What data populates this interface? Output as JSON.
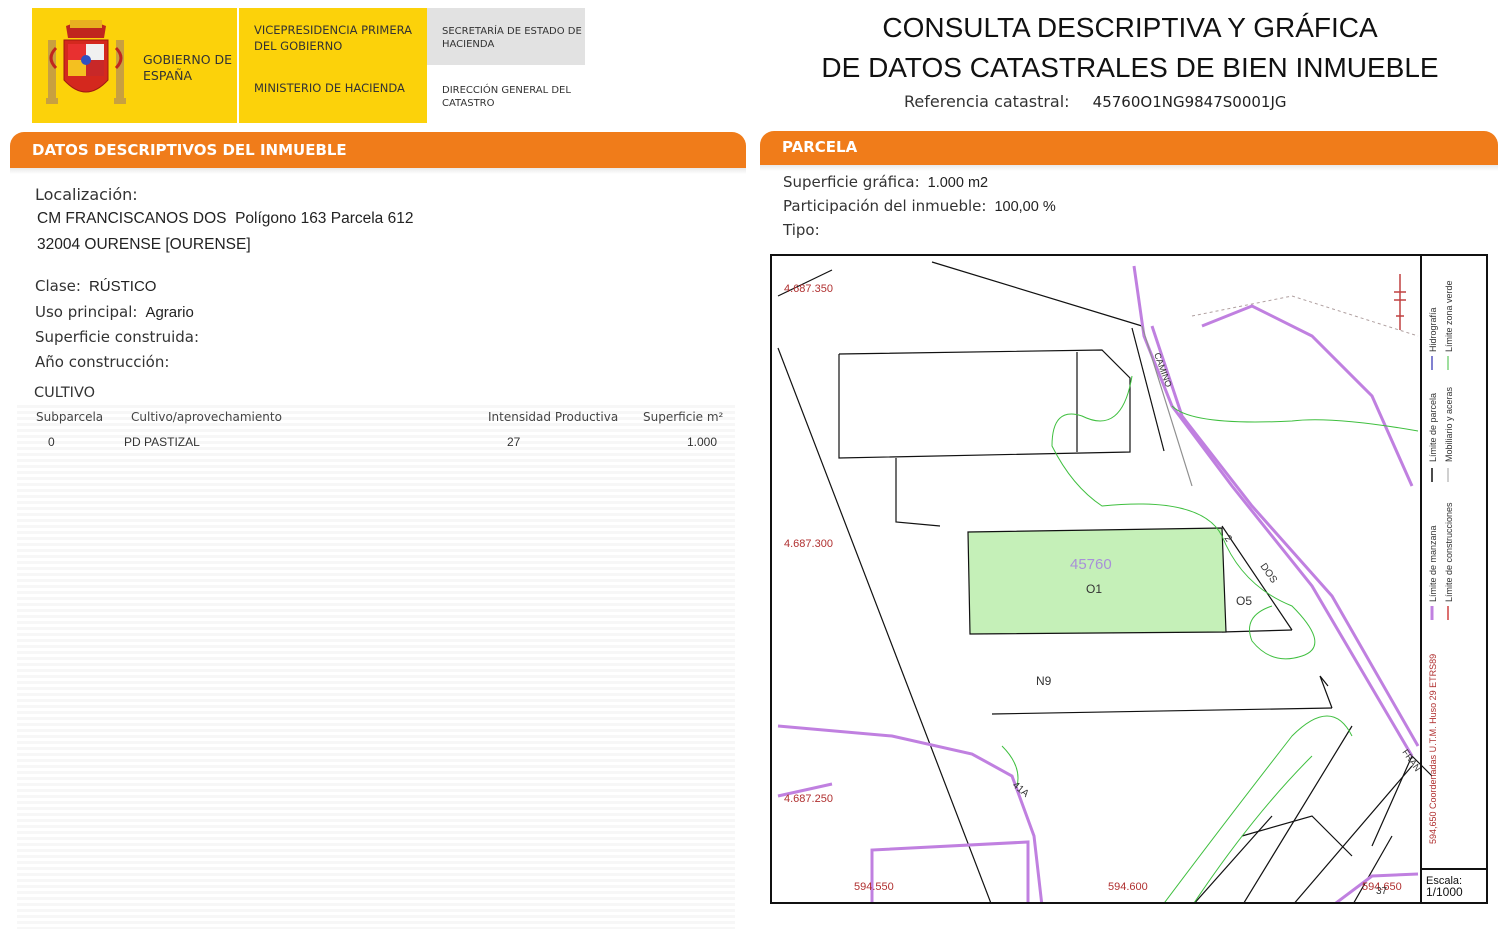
{
  "header": {
    "gobierno": "GOBIERNO DE ESPAÑA",
    "vicepresidencia": "VICEPRESIDENCIA PRIMERA DEL GOBIERNO",
    "ministerio": "MINISTERIO DE HACIENDA",
    "secretaria": "SECRETARÍA DE ESTADO DE HACIENDA",
    "direccion": "DIRECCIÓN GENERAL DEL CATASTRO",
    "title_line1": "CONSULTA DESCRIPTIVA Y GRÁFICA",
    "title_line2": "DE DATOS CATASTRALES DE BIEN INMUEBLE",
    "ref_label": "Referencia catastral:",
    "ref_value": "45760O1NG9847S0001JG",
    "colors": {
      "yellow": "#fcd20a",
      "gray": "#e2e2e2",
      "orange": "#f07c1a"
    }
  },
  "descriptivos": {
    "section_title": "DATOS DESCRIPTIVOS DEL INMUEBLE",
    "localizacion_label": "Localización:",
    "localizacion_line1": "CM FRANCISCANOS DOS  Polígono 163 Parcela 612",
    "localizacion_line2": "32004 OURENSE [OURENSE]",
    "clase_label": "Clase:",
    "clase_value": "RÚSTICO",
    "uso_label": "Uso principal:",
    "uso_value": "Agrario",
    "superficie_construida_label": "Superficie construida:",
    "anio_label": "Año construcción:",
    "cultivo_title": "CULTIVO",
    "table_headers": [
      "Subparcela",
      "Cultivo/aprovechamiento",
      "Intensidad Productiva",
      "Superficie m²"
    ],
    "rows": [
      {
        "subparcela": "0",
        "cultivo": "PD PASTIZAL",
        "intensidad": "27",
        "superficie": "1.000"
      }
    ]
  },
  "parcela": {
    "section_title": "PARCELA",
    "superficie_label": "Superficie gráfica:",
    "superficie_value": "1.000 m2",
    "participacion_label": "Participación del inmueble:",
    "participacion_value": "100,00 %",
    "tipo_label": "Tipo:",
    "map": {
      "parcel_number": "45760",
      "parcel_sub": "O1",
      "label_o5": "O5",
      "label_n9": "N9",
      "coord_y1": "4.687.350",
      "coord_y2": "4.687.300",
      "coord_y3": "4.687.250",
      "coord_x1": "594.550",
      "coord_x2": "594.600",
      "coord_x3": "594.650",
      "street_camino": "CAMINO",
      "street_dos": "DOS",
      "street_fran": "FRAN",
      "street_41a": "41A",
      "street_2": "2",
      "label_37": "37",
      "parcel_fill": "#c5f0b8",
      "boundary_color": "#c080e0",
      "green_line_color": "#3fbf3f"
    },
    "legend": {
      "limite_manzana": "Límite de manzana",
      "limite_parcela": "Límite de parcela",
      "hidrografia": "Hidrografía",
      "limite_construcciones": "Límite de construcciones",
      "mobiliario": "Mobiliario y aceras",
      "limite_zona_verde": "Límite zona verde",
      "coordenadas": "594,650 Coordenadas U.T.M. Huso 29 ETRS89"
    },
    "scale_label": "Escala:",
    "scale_value": "1/1000"
  }
}
